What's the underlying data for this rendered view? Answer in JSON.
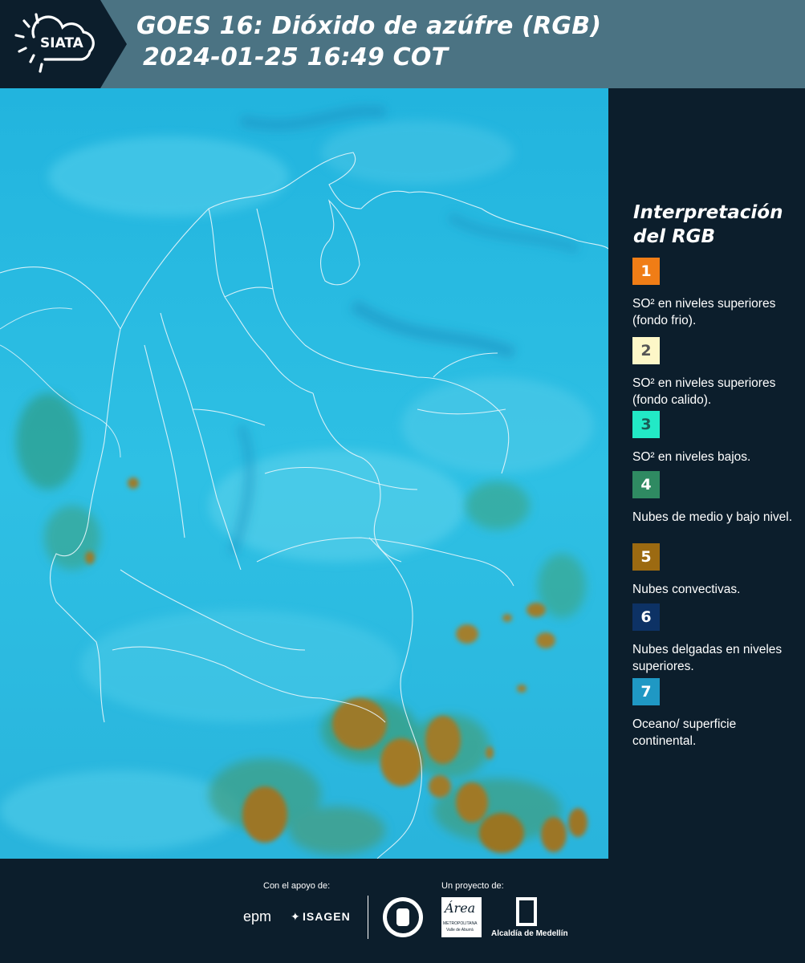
{
  "header": {
    "logo_text": "SIATA",
    "title_line1": "GOES 16: Dióxido de azúfre (RGB)",
    "title_line2": "2024-01-25 16:49 COT"
  },
  "legend": {
    "title_line1": "Interpretación",
    "title_line2": "del RGB",
    "items": [
      {
        "number": "1",
        "label": "SO² en niveles superiores (fondo frio).",
        "color": "#f07d16",
        "number_color": "#ffffff"
      },
      {
        "number": "2",
        "label": "SO² en niveles superiores (fondo calido).",
        "color": "#fdf7c8",
        "number_color": "#555555"
      },
      {
        "number": "3",
        "label": "SO² en niveles bajos.",
        "color": "#22e9c6",
        "number_color": "#1a5c56"
      },
      {
        "number": "4",
        "label": "Nubes de medio y bajo nivel.",
        "color": "#2f8a62",
        "number_color": "#ffffff"
      },
      {
        "number": "5",
        "label": "Nubes convectivas.",
        "color": "#9c6a11",
        "number_color": "#ffffff"
      },
      {
        "number": "6",
        "label": "Nubes delgadas en niveles superiores.",
        "color": "#0d3265",
        "number_color": "#ffffff"
      },
      {
        "number": "7",
        "label": "Oceano/ superficie continental.",
        "color": "#1f98c4",
        "number_color": "#ffffff"
      }
    ]
  },
  "footer": {
    "support_label": "Con el apoyo de:",
    "project_label": "Un proyecto de:",
    "epm_logo": "epm",
    "isagen_logo": "ISAGEN",
    "area_logo": "Área",
    "area_sub": "METROPOLITANA",
    "area_sub2": "Valle de Aburrá",
    "alcaldia_logo": "Alcaldía de Medellín"
  },
  "colors": {
    "header_bg": "#4b7383",
    "panel_bg": "#0c1e2c",
    "map_base": "#27b7e0"
  }
}
